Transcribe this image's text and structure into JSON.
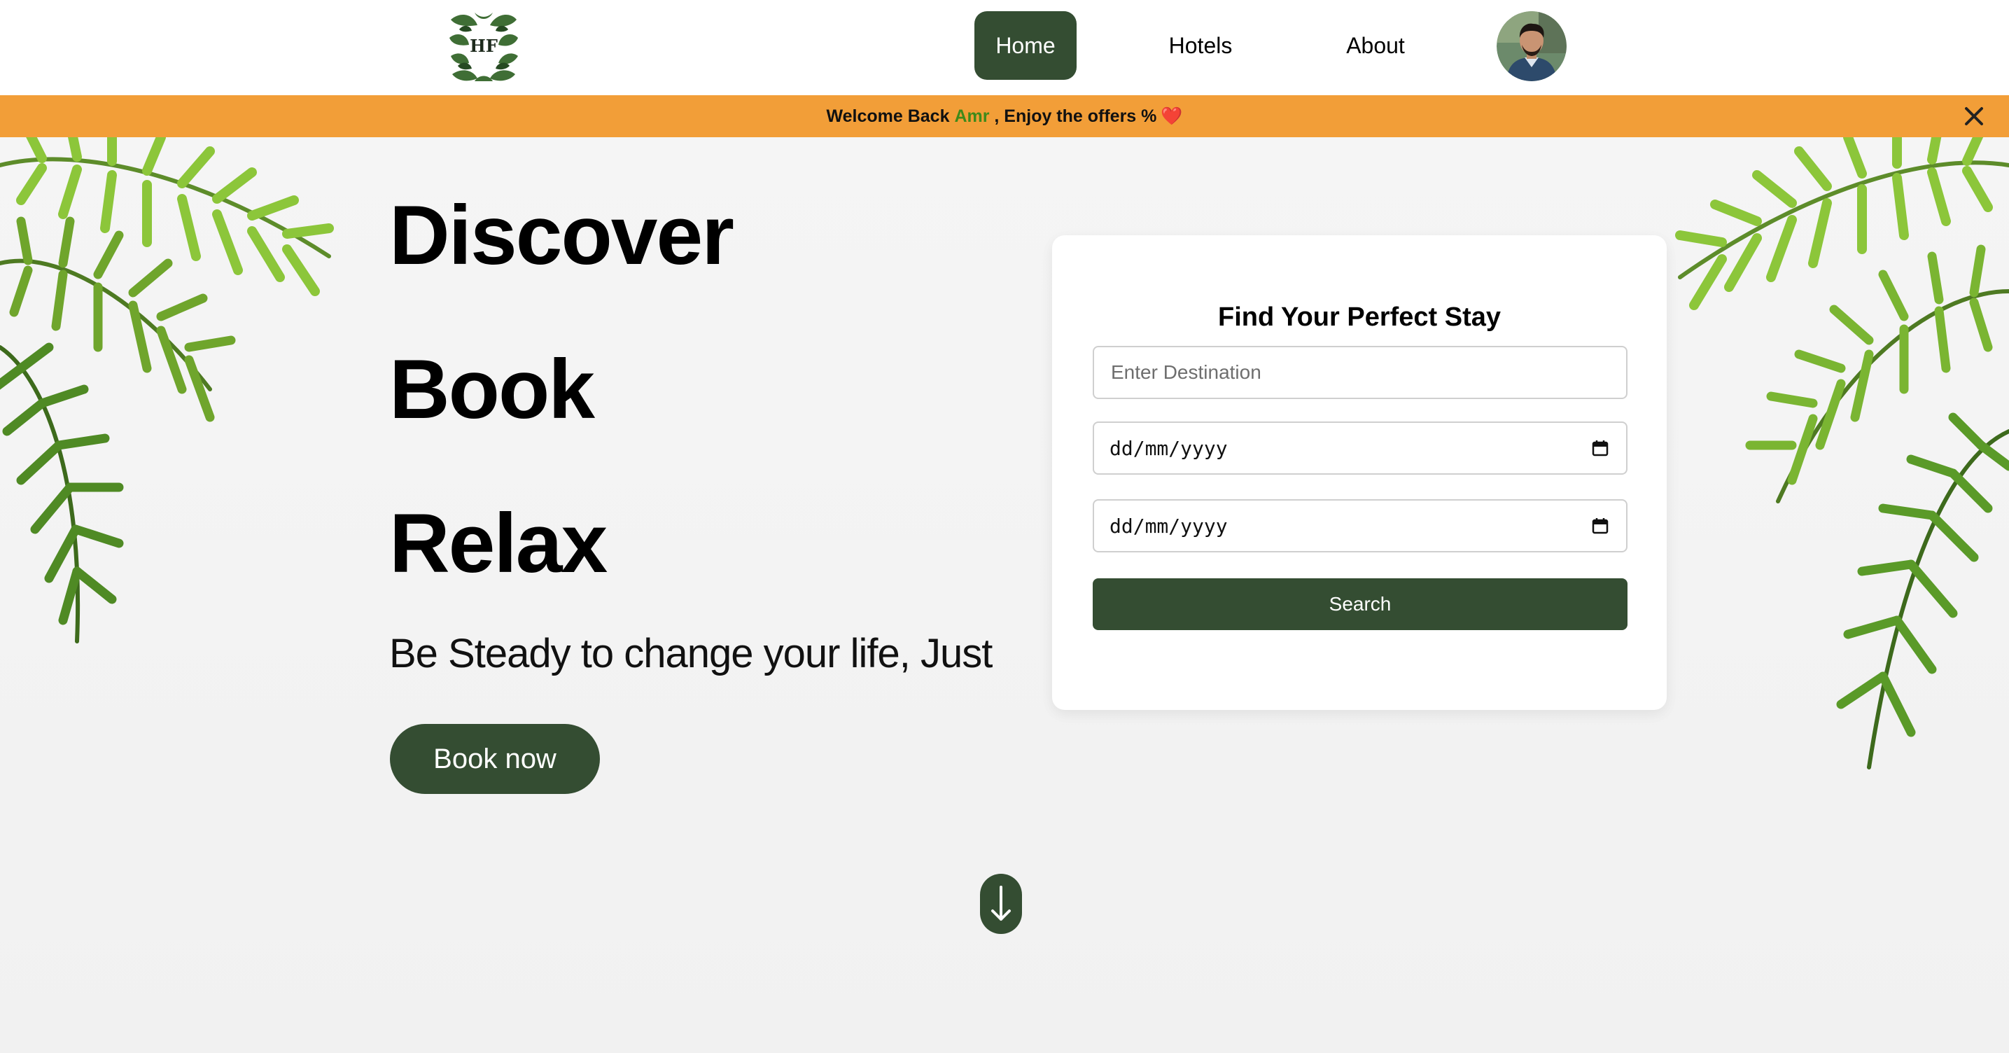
{
  "nav": {
    "logo_text": "HF",
    "items": [
      {
        "label": "Home",
        "active": true
      },
      {
        "label": "Hotels",
        "active": false
      },
      {
        "label": "About",
        "active": false
      }
    ],
    "avatar_icon": "user-avatar"
  },
  "banner": {
    "prefix": "Welcome Back",
    "user": "Amr",
    "suffix": ", Enjoy the offers %",
    "emoji": "❤️",
    "close_icon": "close-icon"
  },
  "hero": {
    "words": [
      "Discover",
      "Book",
      "Relax"
    ],
    "tagline": "Be Steady to change your life, Just",
    "cta_label": "Book now",
    "scroll_icon": "arrow-down-icon"
  },
  "search": {
    "title": "Find Your Perfect Stay",
    "destination_placeholder": "Enter Destination",
    "destination_value": "",
    "checkin_placeholder": "dd/mm/yyyy",
    "checkout_placeholder": "dd/mm/yyyy",
    "button_label": "Search",
    "calendar_icon": "calendar-icon"
  },
  "colors": {
    "primary": "#344d32",
    "banner": "#f29e38",
    "username": "#3f8a1a",
    "background": "#f3f3f3"
  }
}
